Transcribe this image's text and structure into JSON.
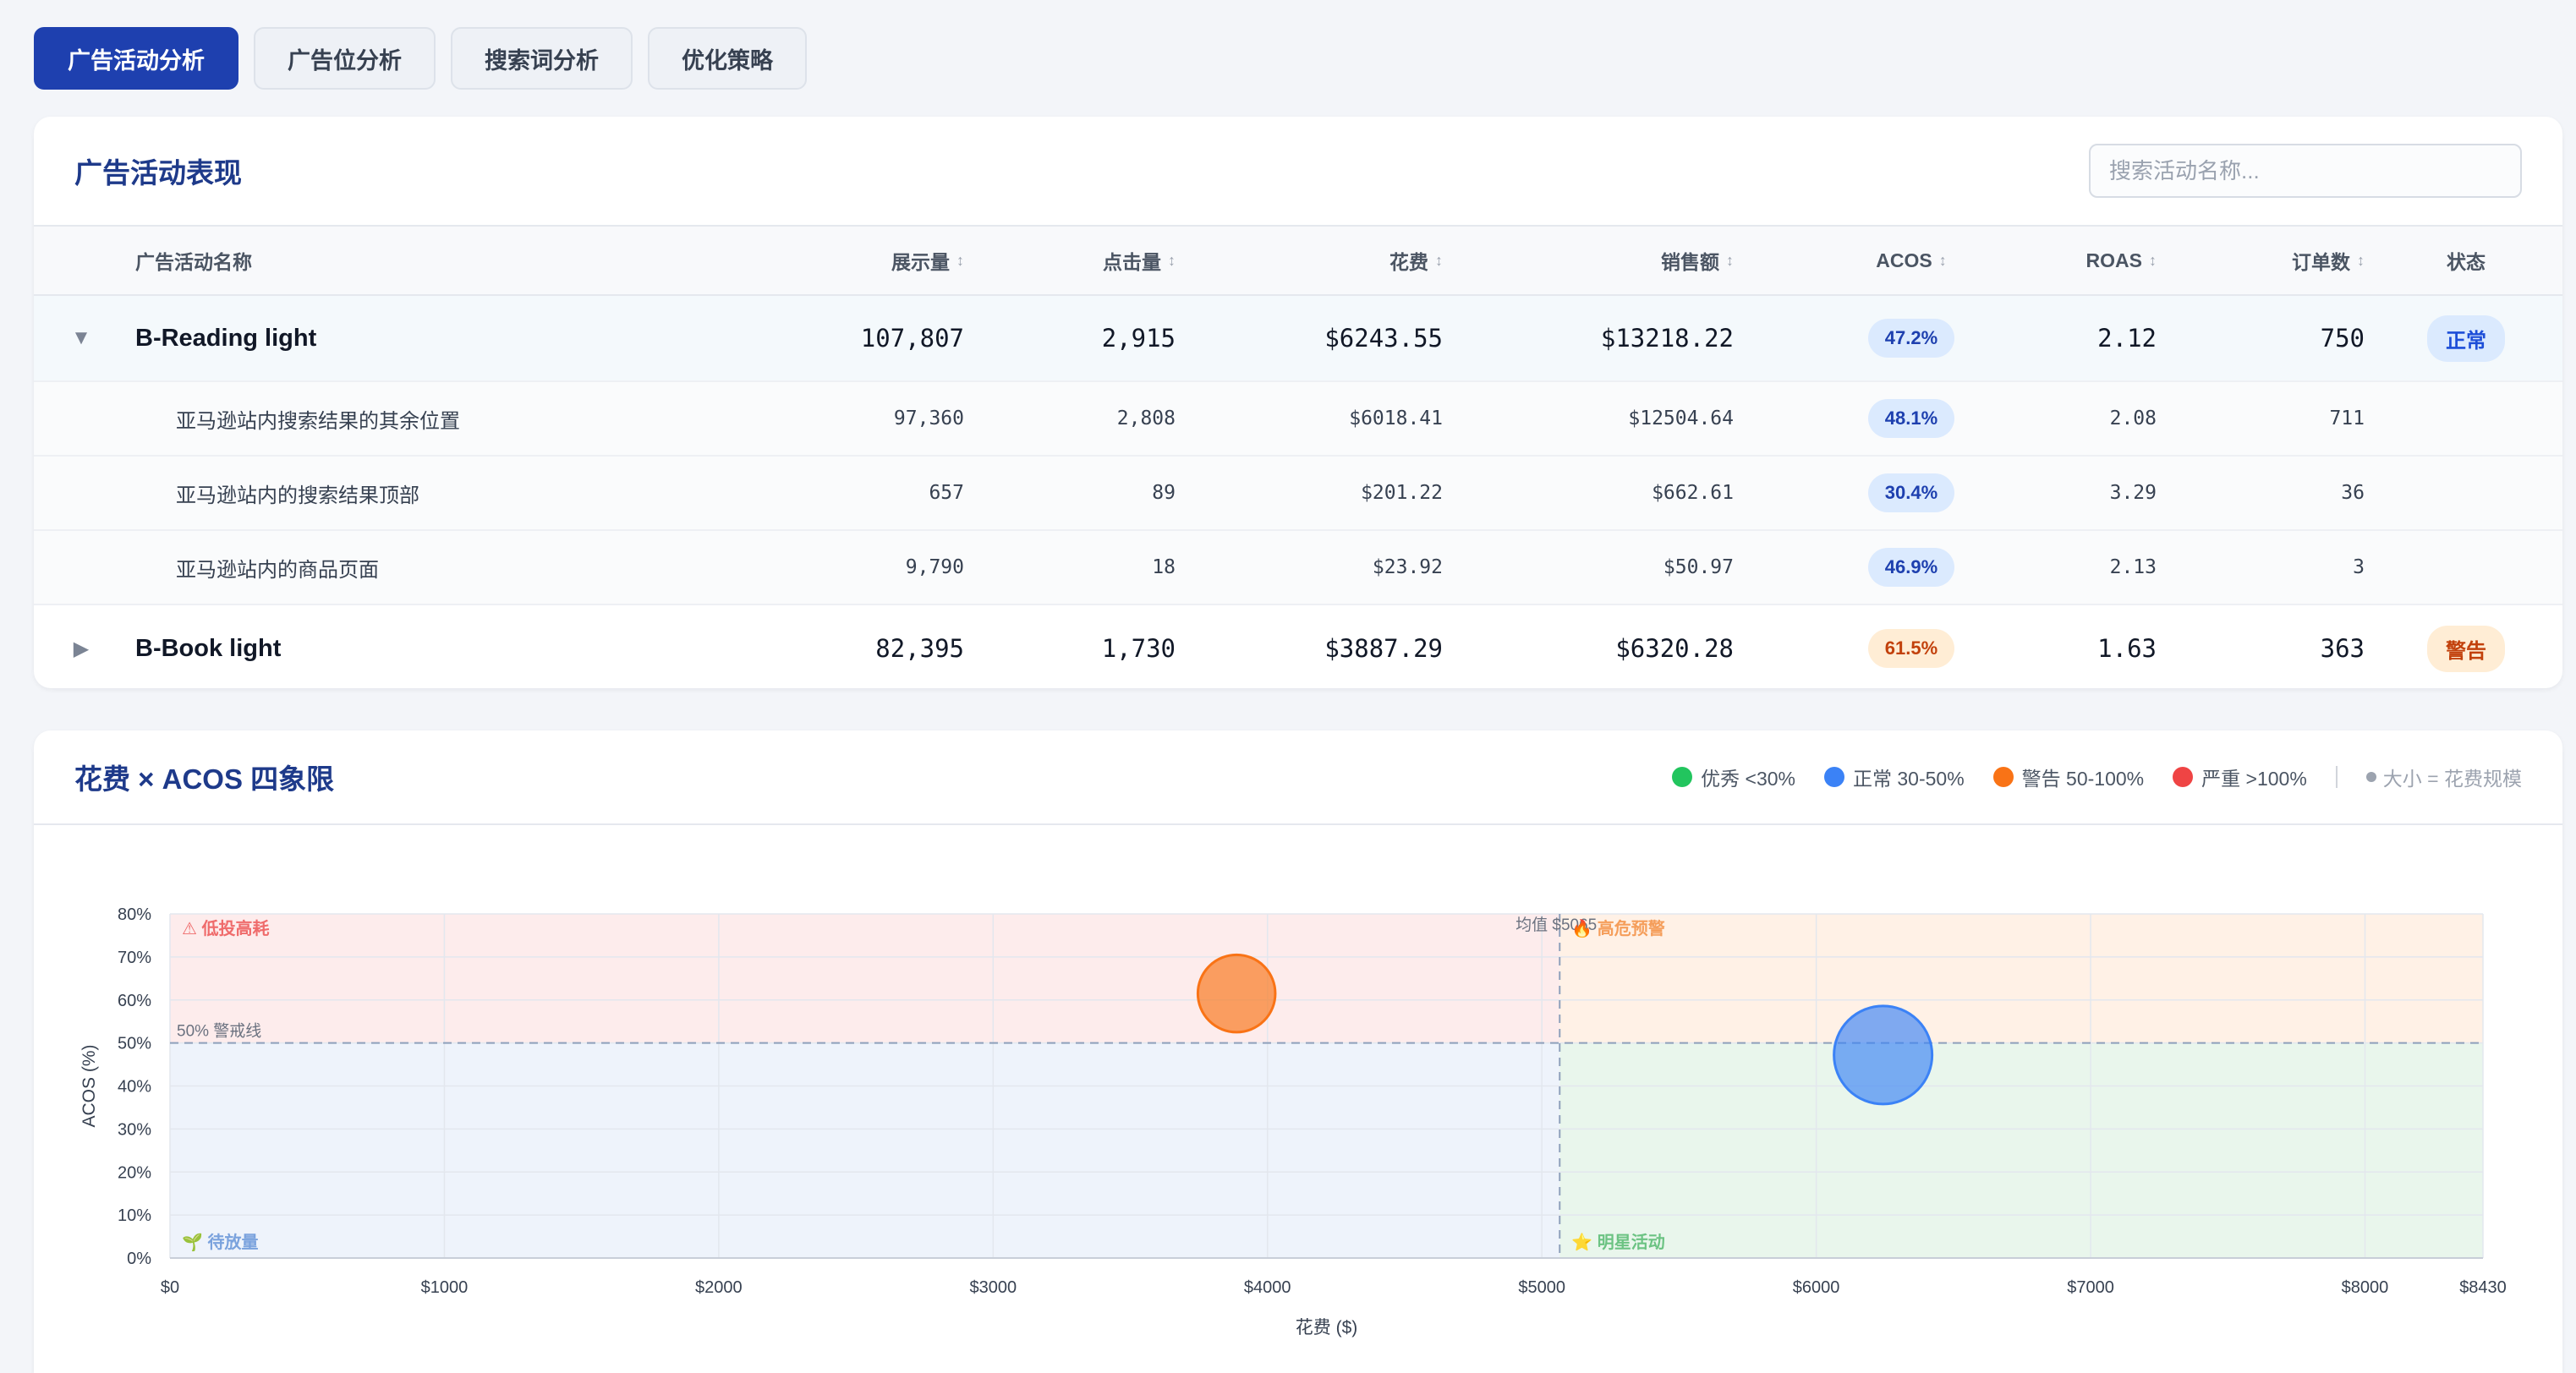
{
  "tabs": [
    {
      "label": "广告活动分析",
      "active": true
    },
    {
      "label": "广告位分析",
      "active": false
    },
    {
      "label": "搜索词分析",
      "active": false
    },
    {
      "label": "优化策略",
      "active": false
    }
  ],
  "campaign_table": {
    "title": "广告活动表现",
    "search_placeholder": "搜索活动名称...",
    "columns": {
      "name": "广告活动名称",
      "impressions": "展示量",
      "clicks": "点击量",
      "spend": "花费",
      "sales": "销售额",
      "acos": "ACOS",
      "roas": "ROAS",
      "orders": "订单数",
      "status": "状态"
    },
    "sort_icon": "↕",
    "rows": [
      {
        "toggle": "▼",
        "name": "B-Reading light",
        "impressions": "107,807",
        "clicks": "2,915",
        "spend": "$6243.55",
        "sales": "$13218.22",
        "acos": "47.2%",
        "roas": "2.12",
        "orders": "750",
        "status": "正常",
        "children": [
          {
            "name": "亚马逊站内搜索结果的其余位置",
            "impressions": "97,360",
            "clicks": "2,808",
            "spend": "$6018.41",
            "sales": "$12504.64",
            "acos": "48.1%",
            "roas": "2.08",
            "orders": "711"
          },
          {
            "name": "亚马逊站内的搜索结果顶部",
            "impressions": "657",
            "clicks": "89",
            "spend": "$201.22",
            "sales": "$662.61",
            "acos": "30.4%",
            "roas": "3.29",
            "orders": "36"
          },
          {
            "name": "亚马逊站内的商品页面",
            "impressions": "9,790",
            "clicks": "18",
            "spend": "$23.92",
            "sales": "$50.97",
            "acos": "46.9%",
            "roas": "2.13",
            "orders": "3"
          }
        ]
      },
      {
        "toggle": "▶",
        "name": "B-Book light",
        "impressions": "82,395",
        "clicks": "1,730",
        "spend": "$3887.29",
        "sales": "$6320.28",
        "acos": "61.5%",
        "roas": "1.63",
        "orders": "363",
        "status": "警告"
      }
    ]
  },
  "quadrant": {
    "title": "花费 × ACOS 四象限",
    "legend": [
      {
        "label": "优秀 <30%",
        "color": "#22c55e"
      },
      {
        "label": "正常 30-50%",
        "color": "#3b82f6"
      },
      {
        "label": "警告 50-100%",
        "color": "#f97316"
      },
      {
        "label": "严重 >100%",
        "color": "#ef4444"
      }
    ],
    "legend_note": "大小 = 花费规模",
    "labels": {
      "top_left": "⚠ 低投高耗",
      "top_right": "🔥 高危预警",
      "bottom_left": "🌱 待放量",
      "bottom_right": "⭐ 明星活动",
      "threshold": "50% 警戒线",
      "mean": "均值 $5065"
    }
  },
  "chart_data": {
    "type": "scatter",
    "title": "花费 × ACOS 四象限",
    "xlabel": "花费 ($)",
    "ylabel": "ACOS (%)",
    "xlim": [
      0,
      8430
    ],
    "ylim": [
      0,
      80
    ],
    "x_ticks": [
      "$0",
      "$1000",
      "$2000",
      "$3000",
      "$4000",
      "$5000",
      "$6000",
      "$7000",
      "$8000",
      "$8430"
    ],
    "y_ticks": [
      "0%",
      "10%",
      "20%",
      "30%",
      "40%",
      "50%",
      "60%",
      "70%",
      "80%"
    ],
    "x_tick_values": [
      0,
      1000,
      2000,
      3000,
      4000,
      5000,
      6000,
      7000,
      8000,
      8430
    ],
    "y_tick_values": [
      0,
      10,
      20,
      30,
      40,
      50,
      60,
      70,
      80
    ],
    "threshold_acos": 50,
    "mean_spend": 5065,
    "points": [
      {
        "campaign": "B-Book light",
        "spend": 3887.29,
        "acos": 61.5,
        "color": "#f97316"
      },
      {
        "campaign": "B-Reading light",
        "spend": 6243.55,
        "acos": 47.2,
        "color": "#3b82f6"
      }
    ],
    "quadrant_colors": {
      "top_left": "#fdecec",
      "top_right": "#fff1e6",
      "bottom_left": "#eef3fb",
      "bottom_right": "#e9f6ec"
    }
  }
}
